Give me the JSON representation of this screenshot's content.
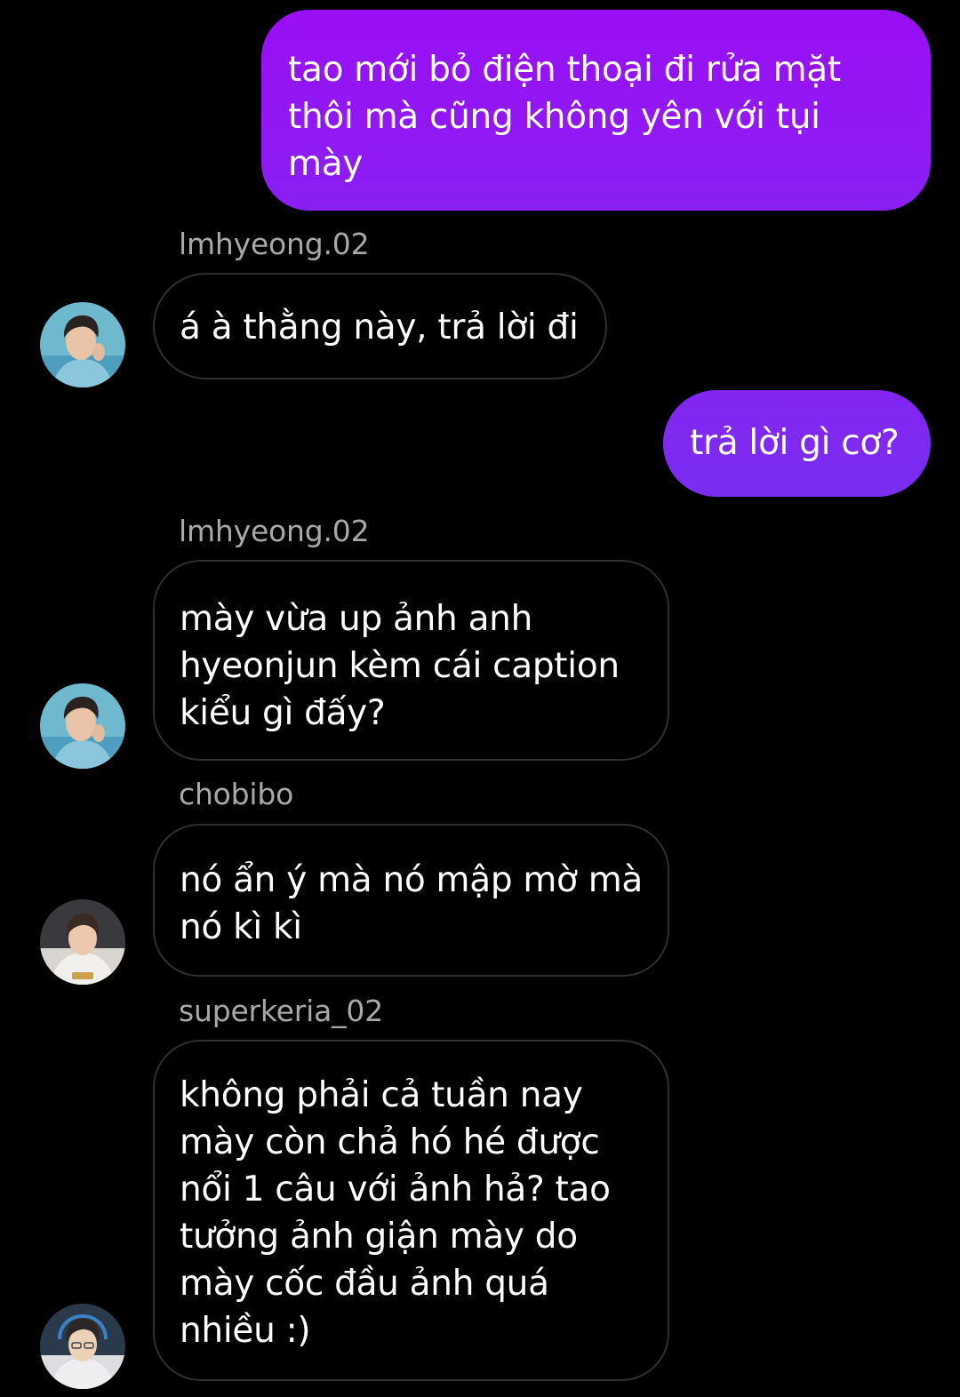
{
  "colors": {
    "background": "#000000",
    "sent_gradient_top": "#9a0ff5",
    "sent_gradient_bottom": "#7a2ef0",
    "received_border": "#2f2f2f",
    "username": "#a8a8a8"
  },
  "messages": [
    {
      "type": "sent",
      "text": "tao mới bỏ điện thoại đi rửa mặt thôi mà cũng không yên với tụi mày"
    },
    {
      "type": "received",
      "sender": "lmhyeong.02",
      "text": "á à thằng này, trả lời đi"
    },
    {
      "type": "sent",
      "text": "trả lời gì cơ?"
    },
    {
      "type": "received",
      "sender": "lmhyeong.02",
      "text": "mày vừa up ảnh anh hyeonjun kèm cái caption kiểu gì đấy?"
    },
    {
      "type": "received",
      "sender": "chobibo",
      "text": "nó ẩn ý mà nó mập mờ mà nó kì kì"
    },
    {
      "type": "received",
      "sender": "superkeria_02",
      "text": "không phải cả tuần nay mày còn chả hó hé được nổi 1 câu với ảnh hả? tao tưởng ảnh giận mày do mày cốc đầu ảnh quá nhiều :)"
    }
  ]
}
